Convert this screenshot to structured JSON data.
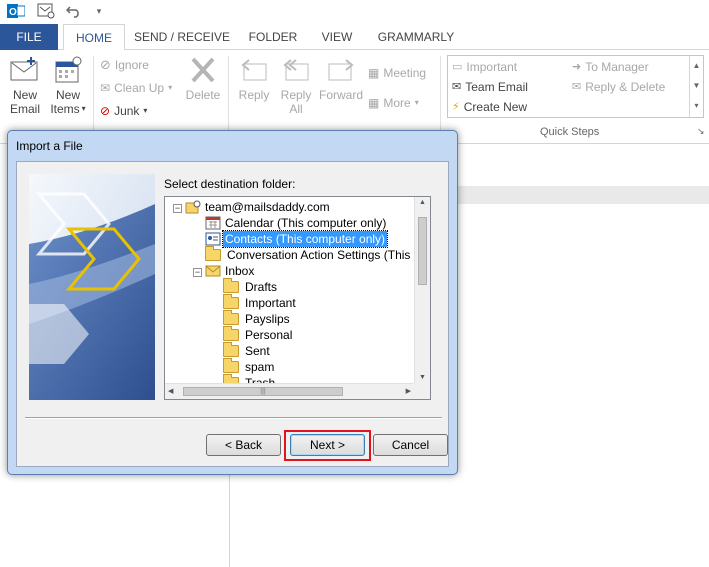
{
  "tabs": {
    "file": "FILE",
    "home": "HOME",
    "send_receive": "SEND / RECEIVE",
    "folder": "FOLDER",
    "view": "VIEW",
    "grammarly": "GRAMMARLY"
  },
  "ribbon": {
    "new_email": [
      "New",
      "Email"
    ],
    "new_items": [
      "New",
      "Items"
    ],
    "ignore": "Ignore",
    "clean_up": "Clean Up",
    "junk": "Junk",
    "delete": "Delete",
    "reply": "Reply",
    "reply_all": [
      "Reply",
      "All"
    ],
    "forward": "Forward",
    "meeting": "Meeting",
    "more": "More",
    "quick_steps": {
      "items": [
        "Important",
        "Team Email",
        "Create New",
        "To Manager",
        "Reply & Delete"
      ],
      "label": "Quick Steps"
    }
  },
  "dialog": {
    "title": "Import a File",
    "select_label": "Select destination folder:",
    "tree": [
      "team@mailsdaddy.com",
      "Calendar (This computer only)",
      "Contacts (This computer only)",
      "Conversation Action Settings (This c",
      "Inbox",
      "Drafts",
      "Important",
      "Payslips",
      "Personal",
      "Sent",
      "spam",
      "Trash"
    ],
    "selected_index": 2,
    "back": "< Back",
    "next": "Next >",
    "cancel": "Cancel"
  },
  "colors": {
    "file_tab": "#2b579a",
    "accent": "#2b579a",
    "dialog_frame": "#c3d9f3",
    "selection": "#3399ff",
    "highlight_box": "#e0141e"
  }
}
